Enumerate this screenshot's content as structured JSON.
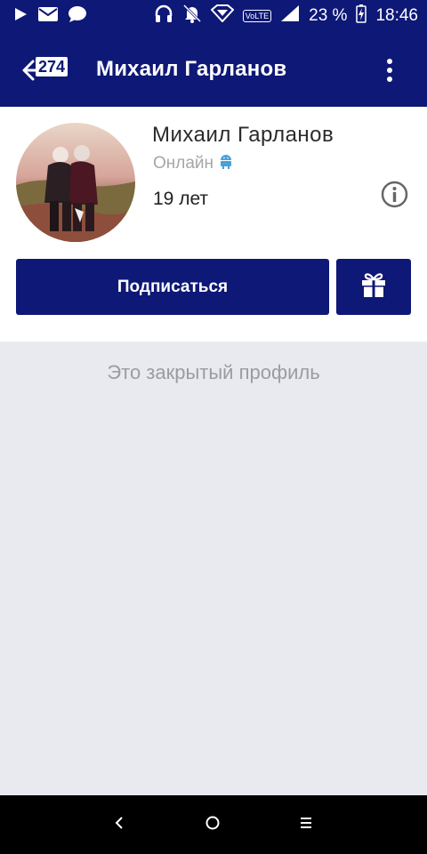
{
  "statusbar": {
    "battery": "23 %",
    "time": "18:46",
    "volte": "VoLTE"
  },
  "appbar": {
    "badge_count": "274",
    "title": "Михаил Гарланов"
  },
  "profile": {
    "name": "Михаил Гарланов",
    "status": "Онлайн",
    "age": "19 лет"
  },
  "actions": {
    "subscribe_label": "Подписаться"
  },
  "content": {
    "private_message": "Это закрытый профиль"
  },
  "colors": {
    "primary": "#0e1876",
    "background": "#e9eaef",
    "android_green": "#4aa0d9"
  },
  "icons": [
    "play-icon",
    "mail-icon",
    "chat-icon",
    "headphones-icon",
    "bell-off-icon",
    "signal-icon",
    "battery-icon",
    "back-arrow-icon",
    "more-vert-icon",
    "android-icon",
    "info-icon",
    "gift-icon",
    "nav-back-icon",
    "nav-home-icon",
    "nav-menu-icon"
  ]
}
